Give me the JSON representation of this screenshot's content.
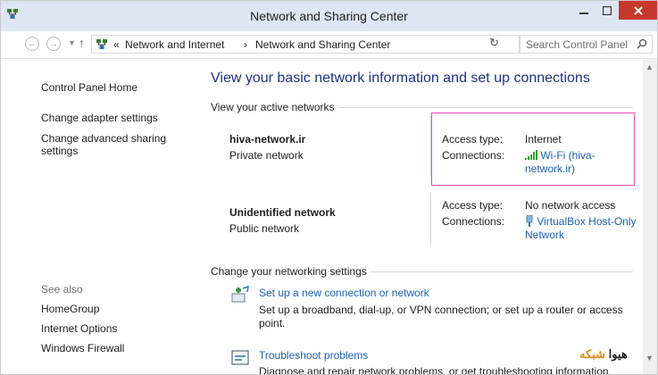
{
  "window": {
    "title": "Network and Sharing Center"
  },
  "address": {
    "overflow": "«",
    "crumbs": [
      "Network and Internet",
      "Network and Sharing Center"
    ],
    "separator": "›",
    "search_placeholder": "Search Control Panel"
  },
  "sidebar": {
    "items": [
      {
        "label": "Control Panel Home"
      },
      {
        "label": "Change adapter settings"
      },
      {
        "label": "Change advanced sharing settings"
      }
    ],
    "see_also_label": "See also",
    "see_also": [
      {
        "label": "HomeGroup"
      },
      {
        "label": "Internet Options"
      },
      {
        "label": "Windows Firewall"
      }
    ]
  },
  "main": {
    "heading": "View your basic network information and set up connections",
    "active_networks_label": "View your active networks",
    "networks": [
      {
        "name": "hiva-network.ir",
        "type": "Private network",
        "access_label": "Access type:",
        "access_value": "Internet",
        "conn_label": "Connections:",
        "conn_value": "Wi-Fi (hiva-network.ir)"
      },
      {
        "name": "Unidentified network",
        "type": "Public network",
        "access_label": "Access type:",
        "access_value": "No network access",
        "conn_label": "Connections:",
        "conn_value_line1": "VirtualBox Host-Only",
        "conn_value_line2": "Network"
      }
    ],
    "settings_label": "Change your networking settings",
    "tasks": [
      {
        "link": "Set up a new connection or network",
        "desc": "Set up a broadband, dial-up, or VPN connection; or set up a router or access point."
      },
      {
        "link": "Troubleshoot problems",
        "desc": "Diagnose and repair network problems, or get troubleshooting information."
      }
    ]
  },
  "watermark": {
    "word1": "هیوا",
    "word2": "شبکه"
  },
  "colors": {
    "heading": "#1e3287",
    "link": "#1c61b3",
    "highlight": "#e64bb8",
    "close": "#c7382c",
    "watermark_accent": "#e28a1c"
  }
}
